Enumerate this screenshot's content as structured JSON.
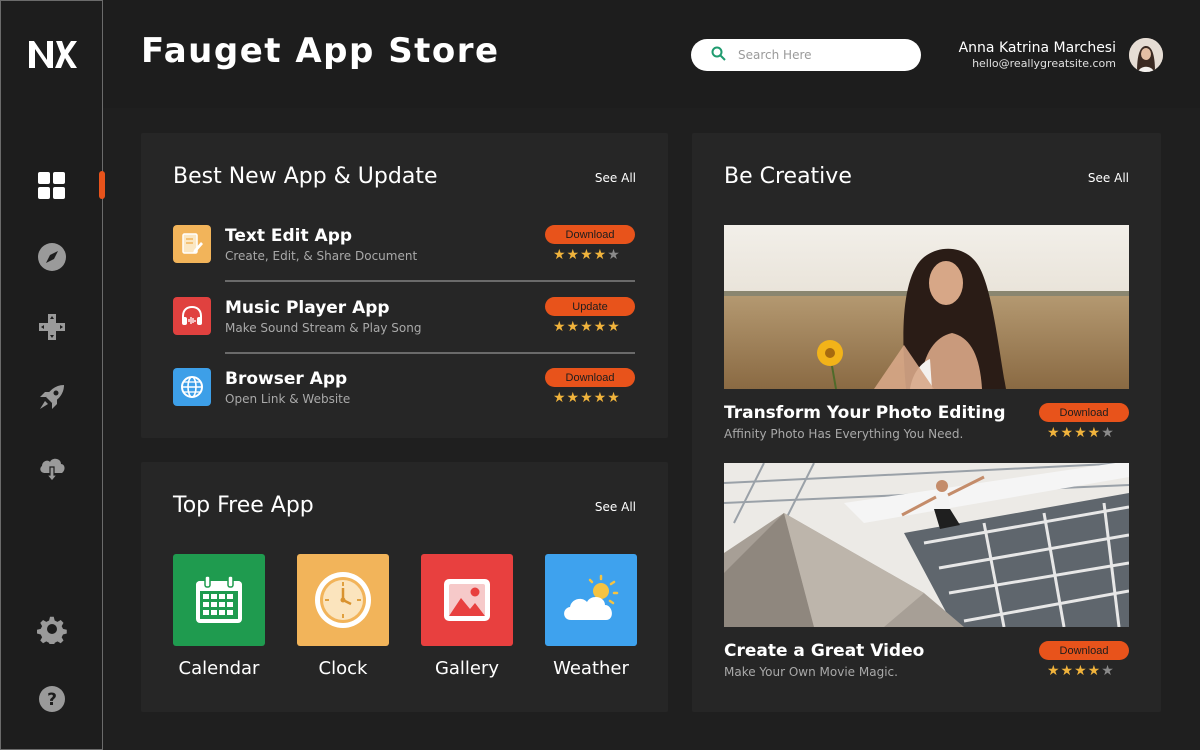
{
  "header": {
    "title": "Fauget App Store",
    "search_placeholder": "Search Here",
    "user_name": "Anna Katrina Marchesi",
    "user_email": "hello@reallygreatsite.com"
  },
  "sidebar": {
    "logo_text": "NK",
    "items": [
      {
        "icon": "grid-icon",
        "active": true
      },
      {
        "icon": "compass-icon",
        "active": false
      },
      {
        "icon": "gamepad-icon",
        "active": false
      },
      {
        "icon": "rocket-icon",
        "active": false
      },
      {
        "icon": "cloud-download-icon",
        "active": false
      },
      {
        "icon": "gear-icon",
        "active": false
      },
      {
        "icon": "help-icon",
        "active": false
      }
    ]
  },
  "best_new": {
    "title": "Best New App & Update",
    "see_all": "See All",
    "apps": [
      {
        "name": "Text Edit App",
        "desc": "Create, Edit, & Share Document",
        "action": "Download",
        "rating": 4,
        "icon": "text-edit-icon",
        "color": "#f2b45a"
      },
      {
        "name": "Music Player App",
        "desc": "Make Sound Stream & Play Song",
        "action": "Update",
        "rating": 5,
        "icon": "headphones-icon",
        "color": "#e0413f"
      },
      {
        "name": "Browser App",
        "desc": "Open Link & Website",
        "action": "Download",
        "rating": 5,
        "icon": "globe-icon",
        "color": "#3d9fe8"
      }
    ]
  },
  "top_free": {
    "title": "Top Free App",
    "see_all": "See All",
    "apps": [
      {
        "name": "Calendar",
        "icon": "calendar-icon",
        "color": "#1f9b4f"
      },
      {
        "name": "Clock",
        "icon": "clock-icon",
        "color": "#f2b45a"
      },
      {
        "name": "Gallery",
        "icon": "gallery-icon",
        "color": "#e8403f"
      },
      {
        "name": "Weather",
        "icon": "weather-icon",
        "color": "#3ea2ee"
      }
    ]
  },
  "be_creative": {
    "title": "Be Creative",
    "see_all": "See All",
    "cards": [
      {
        "title": "Transform Your Photo Editing",
        "desc": "Affinity Photo Has Everything You Need.",
        "action": "Download",
        "rating": 4
      },
      {
        "title": "Create a Great Video",
        "desc": "Make Your Own Movie Magic.",
        "action": "Download",
        "rating": 4
      }
    ]
  },
  "colors": {
    "accent": "#e8531b",
    "star": "#f0b33c",
    "background": "#1f1f1f",
    "panel": "#262626"
  }
}
